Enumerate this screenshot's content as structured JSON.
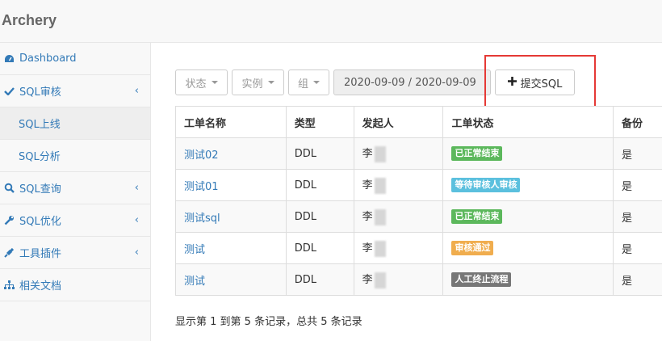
{
  "app": {
    "brand": "Archery"
  },
  "sidebar": {
    "items": [
      {
        "label": "Dashboard",
        "icon": "dashboard-icon",
        "chevron": ""
      },
      {
        "label": "SQL审核",
        "icon": "check-icon",
        "chevron": "‹"
      },
      {
        "label": "SQL上线",
        "sub": true,
        "active": true
      },
      {
        "label": "SQL分析",
        "sub": true
      },
      {
        "label": "SQL查询",
        "icon": "search-icon",
        "chevron": "‹"
      },
      {
        "label": "SQL优化",
        "icon": "wrench-icon",
        "chevron": "‹"
      },
      {
        "label": "工具插件",
        "icon": "plug-icon",
        "chevron": "‹"
      },
      {
        "label": "相关文档",
        "icon": "sitemap-icon",
        "chevron": ""
      }
    ]
  },
  "toolbar": {
    "status_label": "状态",
    "instance_label": "实例",
    "group_label": "组",
    "date_range": "2020-09-09 / 2020-09-09",
    "submit_label": "提交SQL"
  },
  "table": {
    "headers": [
      "工单名称",
      "类型",
      "发起人",
      "工单状态",
      "备份"
    ],
    "rows": [
      {
        "name": "测试02",
        "type": "DDL",
        "initiator": "李",
        "status": "已正常结束",
        "status_color": "#5cb85c",
        "backup": "是"
      },
      {
        "name": "测试01",
        "type": "DDL",
        "initiator": "李",
        "status": "等待审核人审核",
        "status_color": "#5bc0de",
        "backup": "是"
      },
      {
        "name": "测试sql",
        "type": "DDL",
        "initiator": "李",
        "status": "已正常结束",
        "status_color": "#5cb85c",
        "backup": "是"
      },
      {
        "name": "测试",
        "type": "DDL",
        "initiator": "李",
        "status": "审核通过",
        "status_color": "#f0ad4e",
        "backup": "是"
      },
      {
        "name": "测试",
        "type": "DDL",
        "initiator": "李",
        "status": "人工终止流程",
        "status_color": "#777777",
        "backup": "是"
      }
    ]
  },
  "pager": {
    "info": "显示第 1 到第 5 条记录，总共 5 条记录"
  },
  "colors": {
    "link": "#337ab7",
    "highlight": "#e53935"
  }
}
